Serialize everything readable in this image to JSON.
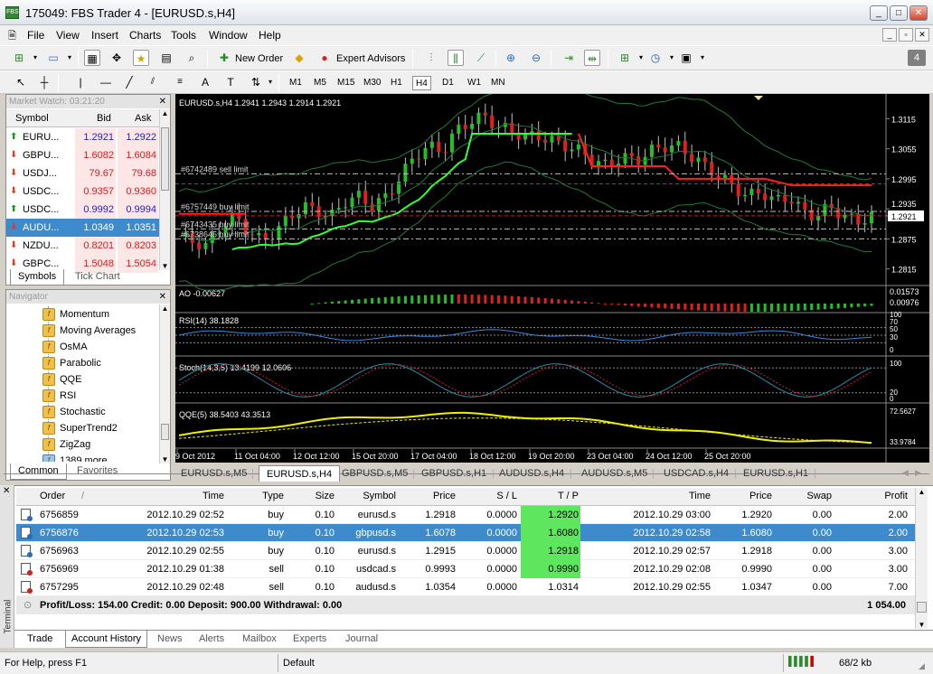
{
  "window": {
    "title": "175049: FBS Trader 4 - [EURUSD.s,H4]"
  },
  "menu": [
    "File",
    "View",
    "Insert",
    "Charts",
    "Tools",
    "Window",
    "Help"
  ],
  "toolbar": {
    "new_order": "New Order",
    "expert_advisors": "Expert Advisors",
    "badge": "4"
  },
  "timeframes": [
    "M1",
    "M5",
    "M15",
    "M30",
    "H1",
    "H4",
    "D1",
    "W1",
    "MN"
  ],
  "timeframe_selected": "H4",
  "market_watch": {
    "header": "Market Watch: 03:21:20",
    "columns": [
      "Symbol",
      "Bid",
      "Ask"
    ],
    "rows": [
      {
        "symbol": "EURU...",
        "bid": "1.2921",
        "ask": "1.2922",
        "dir": "up"
      },
      {
        "symbol": "GBPU...",
        "bid": "1.6082",
        "ask": "1.6084",
        "dir": "down"
      },
      {
        "symbol": "USDJ...",
        "bid": "79.67",
        "ask": "79.68",
        "dir": "down"
      },
      {
        "symbol": "USDC...",
        "bid": "0.9357",
        "ask": "0.9360",
        "dir": "down"
      },
      {
        "symbol": "USDC...",
        "bid": "0.9992",
        "ask": "0.9994",
        "dir": "up"
      },
      {
        "symbol": "AUDU...",
        "bid": "1.0349",
        "ask": "1.0351",
        "dir": "down"
      },
      {
        "symbol": "NZDU...",
        "bid": "0.8201",
        "ask": "0.8203",
        "dir": "down"
      },
      {
        "symbol": "GBPC...",
        "bid": "1.5048",
        "ask": "1.5054",
        "dir": "down"
      }
    ],
    "tabs": [
      "Symbols",
      "Tick Chart"
    ]
  },
  "navigator": {
    "header": "Navigator",
    "items": [
      "Momentum",
      "Moving Averages",
      "OsMA",
      "Parabolic",
      "QQE",
      "RSI",
      "Stochastic",
      "SuperTrend2",
      "ZigZag",
      "1389 more..."
    ],
    "tabs": [
      "Common",
      "Favorites"
    ]
  },
  "chart": {
    "header": "EURUSD.s,H4  1.2941 1.2943 1.2914 1.2921",
    "price_labels": [
      "1.3115",
      "1.3055",
      "1.2995",
      "1.2935",
      "1.2921",
      "1.2875",
      "1.2815"
    ],
    "order_labels": [
      "#6742489 sell limit",
      "#6757449 buy limit",
      "#6743435 buy limit",
      "#6738645 buy limit"
    ],
    "ao_label": "AO -0.00627",
    "ao_scale": [
      "0.01573",
      "0.00976"
    ],
    "rsi_label": "RSI(14) 38.1828",
    "rsi_scale": [
      "100",
      "70",
      "50",
      "30",
      "0"
    ],
    "stoch_label": "Stoch(14,3,5) 13.4199 12.0606",
    "stoch_scale": [
      "100",
      "20",
      "0"
    ],
    "qqe_label": "QQE(5) 38.5403 43.3513",
    "qqe_scale": [
      "72.5627",
      "33.9784"
    ],
    "time_labels": [
      "9 Oct 2012",
      "11 Oct 04:00",
      "12 Oct 12:00",
      "15 Oct 20:00",
      "17 Oct 04:00",
      "18 Oct 12:00",
      "19 Oct 20:00",
      "23 Oct 04:00",
      "24 Oct 12:00",
      "25 Oct 20:00"
    ]
  },
  "chart_tabs": [
    "EURUSD.s,M5",
    "EURUSD.s,H4",
    "GBPUSD.s,M5",
    "GBPUSD.s,H1",
    "AUDUSD.s,H4",
    "AUDUSD.s,M5",
    "USDCAD.s,H4",
    "EURUSD.s,H1"
  ],
  "chart_tab_active": "EURUSD.s,H4",
  "terminal": {
    "columns": [
      "Order",
      "Time",
      "Type",
      "Size",
      "Symbol",
      "Price",
      "S / L",
      "T / P",
      "Time",
      "Price",
      "Swap",
      "Profit"
    ],
    "rows": [
      {
        "order": "6756859",
        "time": "2012.10.29 02:52",
        "type": "buy",
        "size": "0.10",
        "symbol": "eurusd.s",
        "price": "1.2918",
        "sl": "0.0000",
        "tp": "1.2920",
        "tp_hit": true,
        "ctime": "2012.10.29 03:00",
        "cprice": "1.2920",
        "swap": "0.00",
        "profit": "2.00"
      },
      {
        "order": "6756876",
        "time": "2012.10.29 02:53",
        "type": "buy",
        "size": "0.10",
        "symbol": "gbpusd.s",
        "price": "1.6078",
        "sl": "0.0000",
        "tp": "1.6080",
        "tp_hit": true,
        "ctime": "2012.10.29 02:58",
        "cprice": "1.6080",
        "swap": "0.00",
        "profit": "2.00",
        "selected": true
      },
      {
        "order": "6756963",
        "time": "2012.10.29 02:55",
        "type": "buy",
        "size": "0.10",
        "symbol": "eurusd.s",
        "price": "1.2915",
        "sl": "0.0000",
        "tp": "1.2918",
        "tp_hit": true,
        "ctime": "2012.10.29 02:57",
        "cprice": "1.2918",
        "swap": "0.00",
        "profit": "3.00"
      },
      {
        "order": "6756969",
        "time": "2012.10.29 01:38",
        "type": "sell",
        "size": "0.10",
        "symbol": "usdcad.s",
        "price": "0.9993",
        "sl": "0.0000",
        "tp": "0.9990",
        "tp_hit": true,
        "ctime": "2012.10.29 02:08",
        "cprice": "0.9990",
        "swap": "0.00",
        "profit": "3.00"
      },
      {
        "order": "6757295",
        "time": "2012.10.29 02:48",
        "type": "sell",
        "size": "0.10",
        "symbol": "audusd.s",
        "price": "1.0354",
        "sl": "0.0000",
        "tp": "1.0314",
        "tp_hit": false,
        "ctime": "2012.10.29 02:55",
        "cprice": "1.0347",
        "swap": "0.00",
        "profit": "7.00"
      }
    ],
    "summary": "Profit/Loss: 154.00  Credit: 0.00  Deposit: 900.00  Withdrawal: 0.00",
    "total": "1 054.00",
    "side_label": "Terminal",
    "tabs": [
      "Trade",
      "Account History",
      "News",
      "Alerts",
      "Mailbox",
      "Experts",
      "Journal"
    ],
    "tab_active": "Account History"
  },
  "status": {
    "help": "For Help, press F1",
    "profile": "Default",
    "traffic": "68/2 kb"
  }
}
